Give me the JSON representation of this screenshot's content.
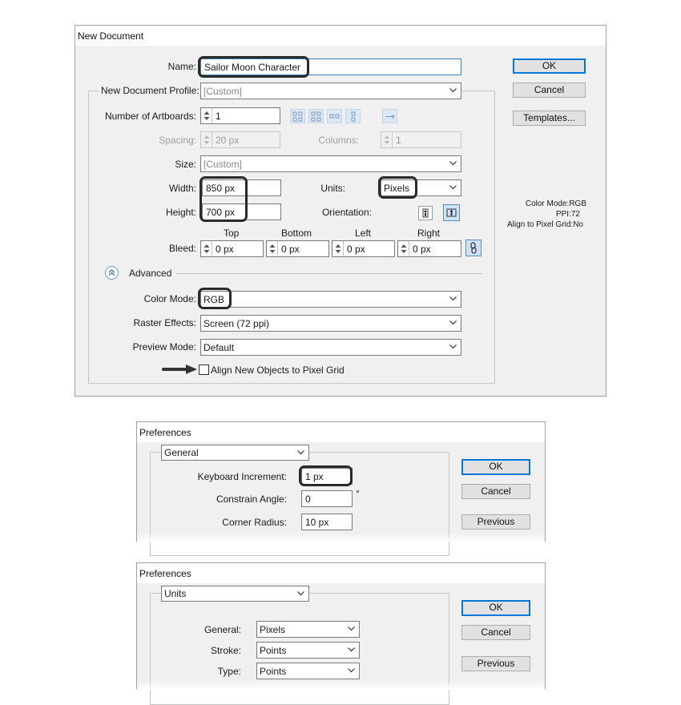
{
  "new_document": {
    "title": "New Document",
    "name_label": "Name:",
    "name_value": "Sailor Moon Character",
    "profile_label": "New Document Profile:",
    "profile_value": "[Custom]",
    "artboards_label": "Number of Artboards:",
    "artboards_value": "1",
    "spacing_label": "Spacing:",
    "spacing_value": "20 px",
    "columns_label": "Columns:",
    "columns_value": "1",
    "size_label": "Size:",
    "size_value": "[Custom]",
    "width_label": "Width:",
    "width_value": "850 px",
    "height_label": "Height:",
    "height_value": "700 px",
    "units_label": "Units:",
    "units_value": "Pixels",
    "orientation_label": "Orientation:",
    "bleed_label": "Bleed:",
    "bleed_headers": {
      "top": "Top",
      "bottom": "Bottom",
      "left": "Left",
      "right": "Right"
    },
    "bleed_values": {
      "top": "0 px",
      "bottom": "0 px",
      "left": "0 px",
      "right": "0 px"
    },
    "advanced_label": "Advanced",
    "color_mode_label": "Color Mode:",
    "color_mode_value": "RGB",
    "raster_label": "Raster Effects:",
    "raster_value": "Screen (72 ppi)",
    "preview_label": "Preview Mode:",
    "preview_value": "Default",
    "align_label": "Align New Objects to Pixel Grid",
    "buttons": {
      "ok": "OK",
      "cancel": "Cancel",
      "templates": "Templates..."
    },
    "info": {
      "color_mode": "Color Mode:RGB",
      "ppi": "PPI:72",
      "align": "Align to Pixel Grid:No"
    }
  },
  "preferences_general": {
    "title": "Preferences",
    "section": "General",
    "keyboard_label": "Keyboard Increment:",
    "keyboard_value": "1 px",
    "constrain_label": "Constrain Angle:",
    "constrain_value": "0",
    "degree_sign": "°",
    "corner_label": "Corner Radius:",
    "corner_value": "10 px",
    "buttons": {
      "ok": "OK",
      "cancel": "Cancel",
      "previous": "Previous"
    }
  },
  "preferences_units": {
    "title": "Preferences",
    "section": "Units",
    "general_label": "General:",
    "general_value": "Pixels",
    "stroke_label": "Stroke:",
    "stroke_value": "Points",
    "type_label": "Type:",
    "type_value": "Points",
    "buttons": {
      "ok": "OK",
      "cancel": "Cancel",
      "previous": "Previous"
    }
  },
  "colors": {
    "dialog_bg": "#f0f0f0",
    "default_button_border": "#0078d7",
    "highlight": "#2a2a2a"
  },
  "icons": [
    "spinner-icon",
    "chevron-down-icon",
    "artboard-layout-icon",
    "portrait-icon",
    "landscape-icon",
    "link-icon",
    "collapse-icon",
    "arrow-icon"
  ]
}
